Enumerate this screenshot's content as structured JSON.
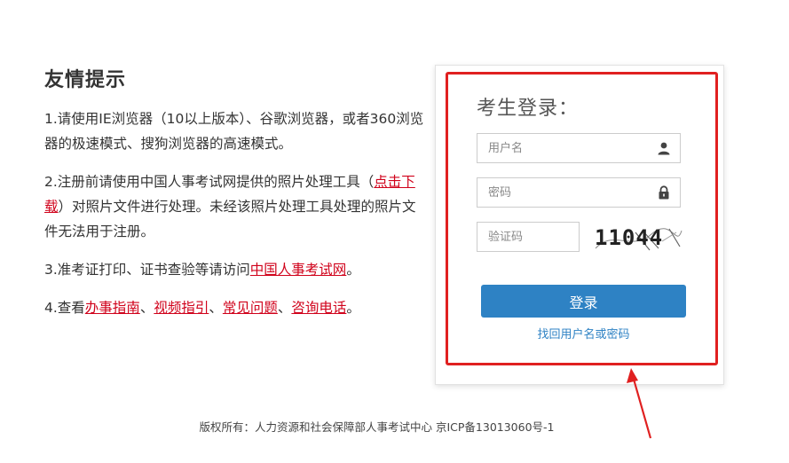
{
  "tips": {
    "title": "友情提示",
    "item1": "1.请使用IE浏览器（10以上版本）、谷歌浏览器，或者360浏览器的极速模式、搜狗浏览器的高速模式。",
    "item2_prefix": "2.注册前请使用中国人事考试网提供的照片处理工具（",
    "item2_link": "点击下载",
    "item2_suffix": "）对照片文件进行处理。未经该照片处理工具处理的照片文件无法用于注册。",
    "item3_prefix": "3.准考证打印、证书查验等请访问",
    "item3_link": "中国人事考试网",
    "item3_suffix": "。",
    "item4_prefix": "4.查看",
    "item4_link1": "办事指南",
    "item4_link2": "视频指引",
    "item4_link3": "常见问题",
    "item4_link4": "咨询电话",
    "sep": "、",
    "end": "。"
  },
  "login": {
    "title": "考生登录：",
    "username_placeholder": "用户名",
    "password_placeholder": "密码",
    "captcha_placeholder": "验证码",
    "captcha_text": "11044",
    "submit_label": "登录",
    "recover_label": "找回用户名或密码"
  },
  "footer": {
    "text": "版权所有：人力资源和社会保障部人事考试中心 京ICP备13013060号-1"
  },
  "colors": {
    "accent": "#2e82c4",
    "link_red": "#d0021b",
    "frame_red": "#e02020"
  }
}
